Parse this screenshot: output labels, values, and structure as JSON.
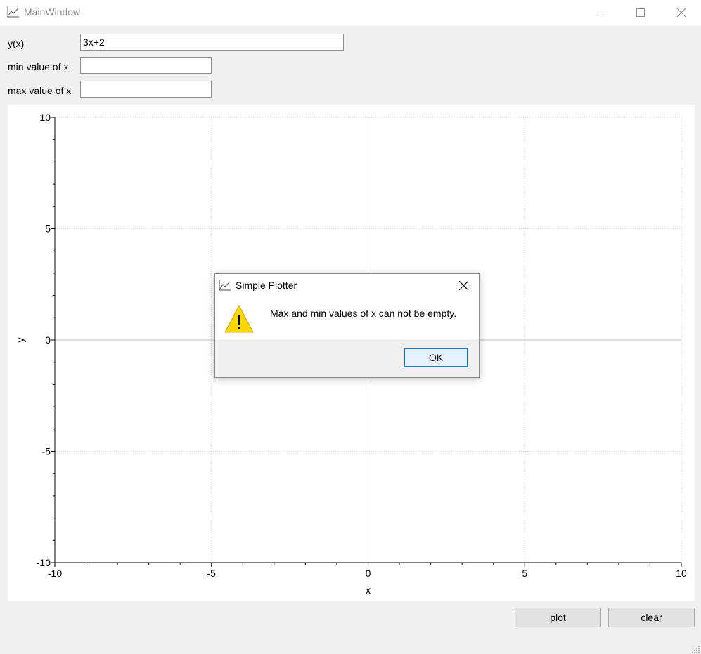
{
  "window": {
    "title": "MainWindow",
    "icon": "chart-line-icon",
    "controls": [
      "minimize-icon",
      "maximize-icon",
      "close-icon"
    ]
  },
  "form": {
    "function_label": "y(x)",
    "function_value": "3x+2",
    "min_label": "min value of x",
    "min_value": "",
    "max_label": "max value of x",
    "max_value": ""
  },
  "chart_data": {
    "type": "line",
    "title": "",
    "xlabel": "x",
    "ylabel": "y",
    "xlim": [
      -10,
      10
    ],
    "ylim": [
      -10,
      10
    ],
    "xticks": [
      -10,
      -5,
      0,
      5,
      10
    ],
    "yticks": [
      -10,
      -5,
      0,
      5,
      10
    ],
    "grid": true,
    "series": []
  },
  "buttons": {
    "plot_label": "plot",
    "clear_label": "clear"
  },
  "dialog": {
    "title": "Simple Plotter",
    "icon": "chart-line-icon",
    "warning_icon": "warning-icon",
    "message": "Max and min values of x can not be empty.",
    "ok_label": "OK"
  }
}
